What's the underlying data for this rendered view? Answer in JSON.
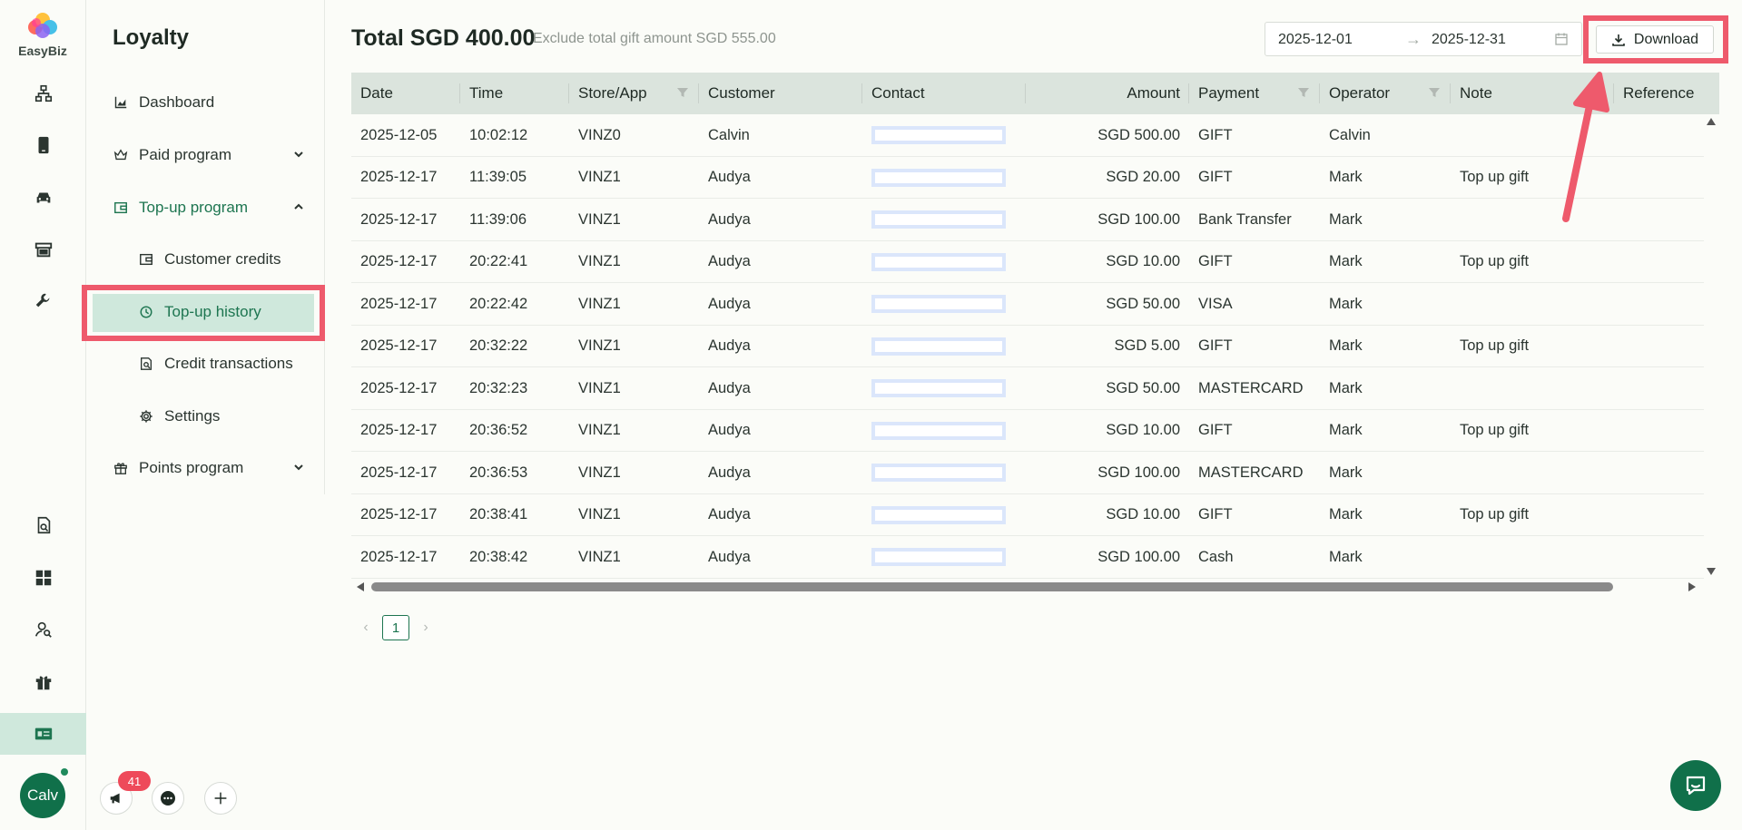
{
  "app": {
    "brand": "EasyBiz"
  },
  "nav": {
    "title": "Loyalty",
    "items": [
      {
        "label": "Dashboard",
        "icon": "chart-icon"
      },
      {
        "label": "Paid program",
        "icon": "crown-icon",
        "expandable": true
      },
      {
        "label": "Top-up program",
        "icon": "wallet-icon",
        "expanded": true
      },
      {
        "label": "Customer credits",
        "icon": "wallet-icon"
      },
      {
        "label": "Top-up history",
        "icon": "history-icon",
        "selected": true
      },
      {
        "label": "Credit transactions",
        "icon": "receipt-search-icon"
      },
      {
        "label": "Settings",
        "icon": "gear-icon"
      },
      {
        "label": "Points program",
        "icon": "gift-icon",
        "expandable": true
      }
    ]
  },
  "header": {
    "total": "Total SGD 400.00",
    "exclude": "Exclude total gift amount SGD 555.00",
    "date_start": "2025-12-01",
    "date_end": "2025-12-31",
    "arrow": "→",
    "download_label": "Download"
  },
  "table": {
    "columns": [
      "Date",
      "Time",
      "Store/App",
      "Customer",
      "Contact",
      "Amount",
      "Payment",
      "Operator",
      "Note",
      "Reference"
    ],
    "rows": [
      [
        "2025-12-05",
        "10:02:12",
        "VINZ0",
        "Calvin",
        "",
        "SGD 500.00",
        "GIFT",
        "Calvin",
        ""
      ],
      [
        "2025-12-17",
        "11:39:05",
        "VINZ1",
        "Audya",
        "",
        "SGD 20.00",
        "GIFT",
        "Mark",
        "Top up gift"
      ],
      [
        "2025-12-17",
        "11:39:06",
        "VINZ1",
        "Audya",
        "",
        "SGD 100.00",
        "Bank Transfer",
        "Mark",
        ""
      ],
      [
        "2025-12-17",
        "20:22:41",
        "VINZ1",
        "Audya",
        "",
        "SGD 10.00",
        "GIFT",
        "Mark",
        "Top up gift"
      ],
      [
        "2025-12-17",
        "20:22:42",
        "VINZ1",
        "Audya",
        "",
        "SGD 50.00",
        "VISA",
        "Mark",
        ""
      ],
      [
        "2025-12-17",
        "20:32:22",
        "VINZ1",
        "Audya",
        "",
        "SGD 5.00",
        "GIFT",
        "Mark",
        "Top up gift"
      ],
      [
        "2025-12-17",
        "20:32:23",
        "VINZ1",
        "Audya",
        "",
        "SGD 50.00",
        "MASTERCARD",
        "Mark",
        ""
      ],
      [
        "2025-12-17",
        "20:36:52",
        "VINZ1",
        "Audya",
        "",
        "SGD 10.00",
        "GIFT",
        "Mark",
        "Top up gift"
      ],
      [
        "2025-12-17",
        "20:36:53",
        "VINZ1",
        "Audya",
        "",
        "SGD 100.00",
        "MASTERCARD",
        "Mark",
        ""
      ],
      [
        "2025-12-17",
        "20:38:41",
        "VINZ1",
        "Audya",
        "",
        "SGD 10.00",
        "GIFT",
        "Mark",
        "Top up gift"
      ],
      [
        "2025-12-17",
        "20:38:42",
        "VINZ1",
        "Audya",
        "",
        "SGD 100.00",
        "Cash",
        "Mark",
        ""
      ]
    ]
  },
  "pagination": {
    "current": "1"
  },
  "user": {
    "initials": "Calv",
    "notifications": "41"
  },
  "colors": {
    "brand_green": "#10704a",
    "highlight_red": "#ee5a6c",
    "selected_bg": "#cfe8dc",
    "header_bg": "#dbe4dd"
  }
}
